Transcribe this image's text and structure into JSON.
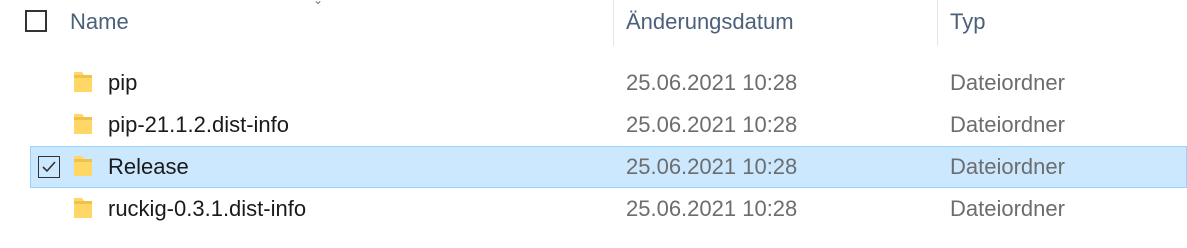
{
  "header": {
    "name_label": "Name",
    "date_label": "Änderungsdatum",
    "type_label": "Typ"
  },
  "rows": [
    {
      "name": "pip",
      "date": "25.06.2021 10:28",
      "type": "Dateiordner",
      "selected": false
    },
    {
      "name": "pip-21.1.2.dist-info",
      "date": "25.06.2021 10:28",
      "type": "Dateiordner",
      "selected": false
    },
    {
      "name": "Release",
      "date": "25.06.2021 10:28",
      "type": "Dateiordner",
      "selected": true
    },
    {
      "name": "ruckig-0.3.1.dist-info",
      "date": "25.06.2021 10:28",
      "type": "Dateiordner",
      "selected": false
    }
  ],
  "colors": {
    "selection_bg": "#cce8ff",
    "selection_border": "#99d1ff",
    "header_text": "#4c607a",
    "folder_yellow": "#ffd767"
  }
}
